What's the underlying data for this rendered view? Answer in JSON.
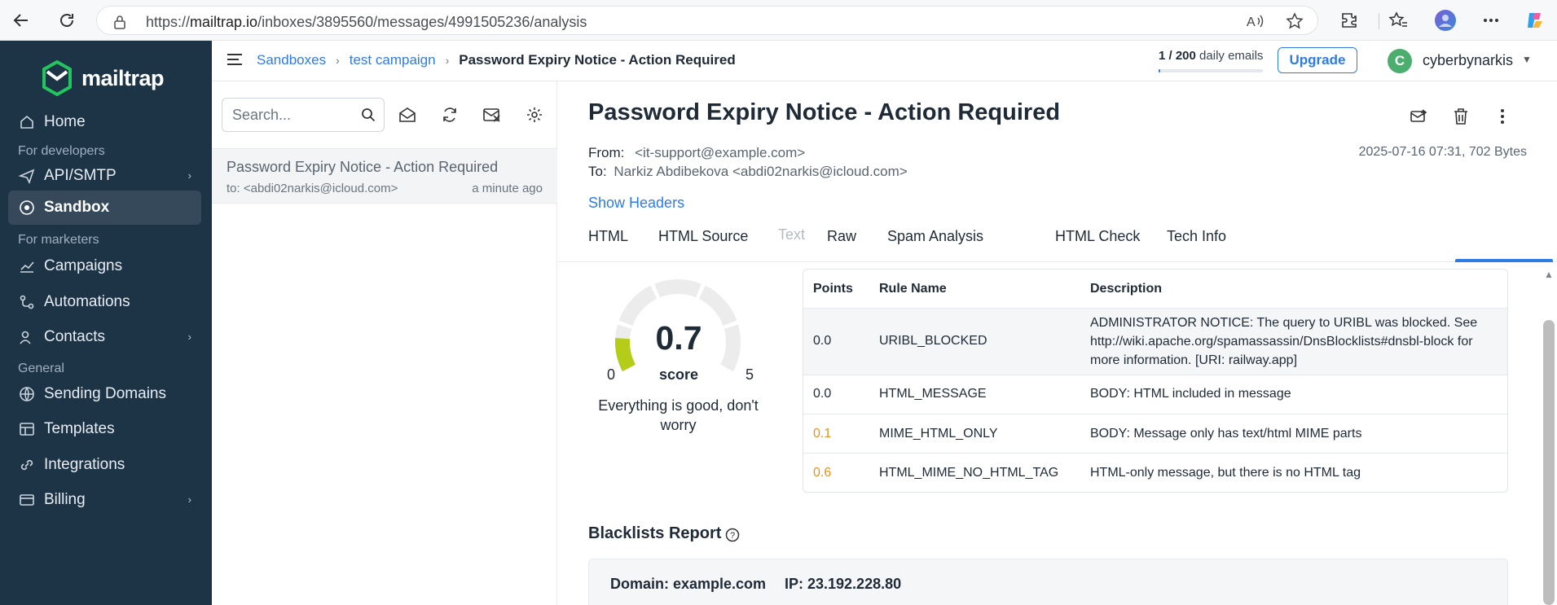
{
  "browser": {
    "url_prefix": "https://",
    "url_host": "mailtrap.io",
    "url_path": "/inboxes/3895560/messages/4991505236/analysis"
  },
  "sidebar": {
    "logo_text": "mailtrap",
    "home": "Home",
    "section_developers": "For developers",
    "api_smtp": "API/SMTP",
    "sandbox": "Sandbox",
    "section_marketers": "For marketers",
    "campaigns": "Campaigns",
    "automations": "Automations",
    "contacts": "Contacts",
    "section_general": "General",
    "sending_domains": "Sending Domains",
    "templates": "Templates",
    "integrations": "Integrations",
    "billing": "Billing"
  },
  "topbar": {
    "crumb_1": "Sandboxes",
    "crumb_2": "test campaign",
    "crumb_3": "Password Expiry Notice - Action Required",
    "usage_count": "1 / 200",
    "usage_label": "daily emails",
    "usage_fraction": 0.005,
    "upgrade": "Upgrade",
    "avatar_letter": "C",
    "username": "cyberbynarkis"
  },
  "messages": {
    "search_placeholder": "Search...",
    "items": [
      {
        "subject": "Password Expiry Notice - Action Required",
        "to": "to: <abdi02narkis@icloud.com>",
        "time": "a minute ago"
      }
    ]
  },
  "message": {
    "subject": "Password Expiry Notice - Action Required",
    "from_label": "From:",
    "from_value": "<it-support@example.com>",
    "to_label": "To:",
    "to_value": "Narkiz Abdibekova <abdi02narkis@icloud.com>",
    "date": "2025-07-16 07:31, 702 Bytes",
    "show_headers": "Show Headers",
    "tabs": [
      "HTML",
      "HTML Source",
      "Text",
      "Raw",
      "Spam Analysis",
      "HTML Check",
      "Tech Info"
    ],
    "active_tab": "Spam Analysis"
  },
  "spam": {
    "score": "0.7",
    "score_value": 0.7,
    "score_max_value": 5,
    "score_label": "score",
    "min": "0",
    "max": "5",
    "message": "Everything is good, don't worry",
    "headers": [
      "Points",
      "Rule Name",
      "Description"
    ],
    "rules": [
      {
        "points": "0.0",
        "name": "URIBL_BLOCKED",
        "desc": "ADMINISTRATOR NOTICE: The query to URIBL was blocked. See http://wiki.apache.org/spamassassin/DnsBlocklists#dnsbl-block for more information. [URI: railway.app]"
      },
      {
        "points": "0.0",
        "name": "HTML_MESSAGE",
        "desc": "BODY: HTML included in message"
      },
      {
        "points": "0.1",
        "name": "MIME_HTML_ONLY",
        "desc": "BODY: Message only has text/html MIME parts"
      },
      {
        "points": "0.6",
        "name": "HTML_MIME_NO_HTML_TAG",
        "desc": "HTML-only message, but there is no HTML tag"
      }
    ]
  },
  "blacklists": {
    "title": "Blacklists Report",
    "domain": "Domain: example.com",
    "ip": "IP: 23.192.228.80"
  },
  "colors": {
    "sidebar_bg": "#1d3447",
    "accent": "#2f7be5",
    "gauge_fill": "#b5cc18",
    "warn": "#e8901a"
  }
}
